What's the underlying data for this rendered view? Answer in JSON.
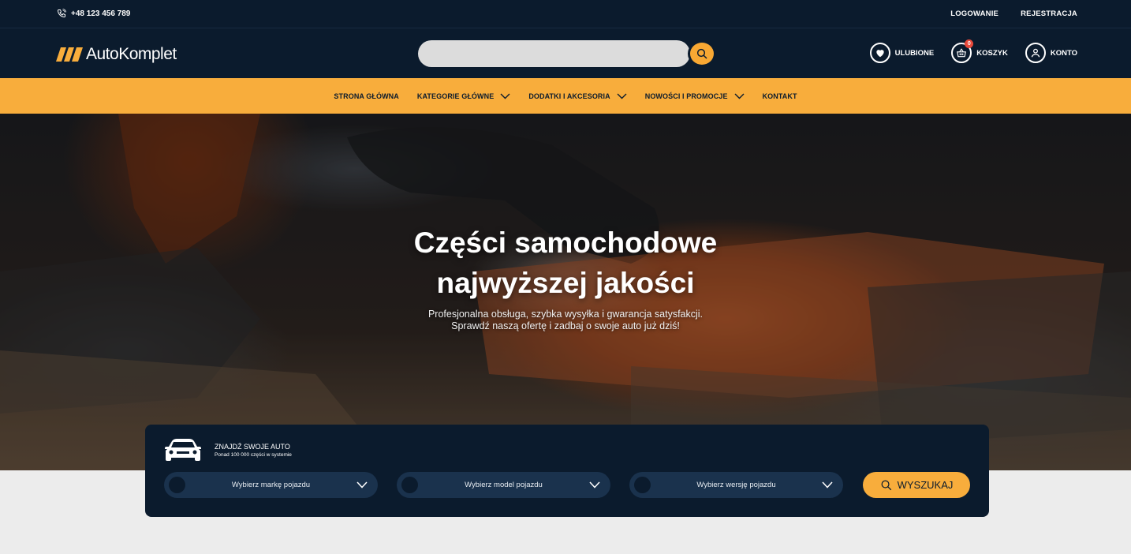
{
  "topbar": {
    "phone": "+48 123 456 789",
    "login": "LOGOWANIE",
    "register": "REJESTRACJA"
  },
  "header": {
    "logo_text": "AutoKomplet",
    "search_placeholder": "",
    "favorites": "ULUBIONE",
    "cart": "KOSZYK",
    "cart_count": "0",
    "account": "KONTO"
  },
  "nav": {
    "items": [
      {
        "label": "STRONA GŁÓWNA",
        "dropdown": false
      },
      {
        "label": "KATEGORIE GŁÓWNE",
        "dropdown": true
      },
      {
        "label": "DODATKI I AKCESORIA",
        "dropdown": true
      },
      {
        "label": "NOWOŚCI I PROMOCJE",
        "dropdown": true
      },
      {
        "label": "KONTAKT",
        "dropdown": false
      }
    ]
  },
  "hero": {
    "title_line1": "Części samochodowe",
    "title_line2": "najwyższej jakości",
    "subtitle_line1": "Profesjonalna obsługa, szybka wysyłka i gwarancja satysfakcji.",
    "subtitle_line2": "Sprawdź naszą ofertę i zadbaj o swoje auto już dziś!"
  },
  "finder": {
    "title": "ZNAJDŹ SWOJE AUTO",
    "subtitle": "Ponad 100 000 części w systemie",
    "select_make": "Wybierz markę pojazdu",
    "select_model": "Wybierz model pojazdu",
    "select_version": "Wybierz wersję pojazdu",
    "search_button": "WYSZUKAJ"
  },
  "colors": {
    "navy": "#0b1b2d",
    "accent": "#f8ad3c",
    "select_bg": "#1a324d"
  }
}
